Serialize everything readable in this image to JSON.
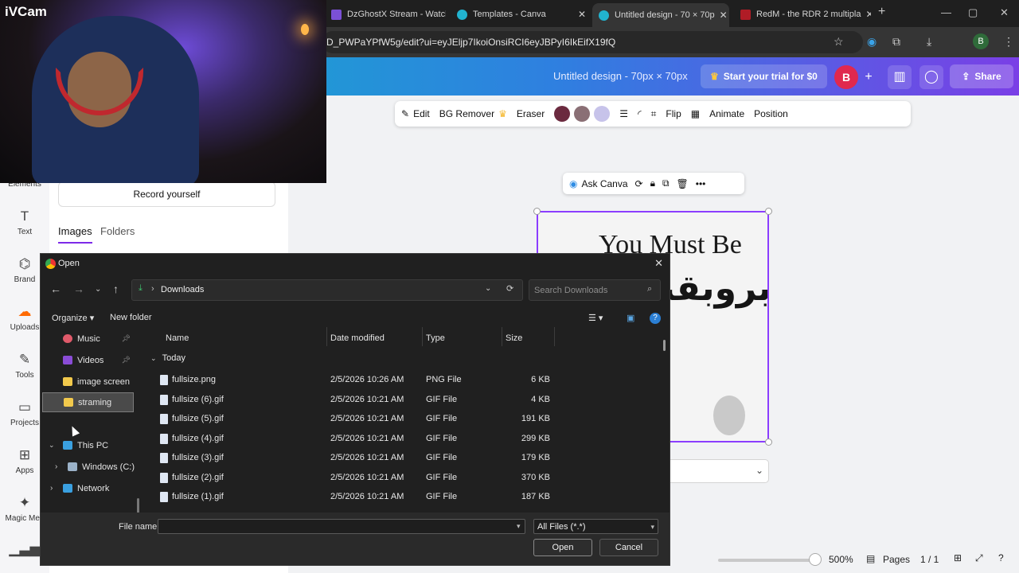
{
  "browser": {
    "tabs": [
      {
        "title": "DzGhostX Stream - Watch",
        "active": false
      },
      {
        "title": "Templates - Canva",
        "active": false
      },
      {
        "title": "Untitled design - 70 × 70p",
        "active": true
      },
      {
        "title": "RedM - the RDR 2 multipla",
        "active": false
      }
    ],
    "new_tab": "+",
    "url": "D_PWPaYPfW5g/edit?ui=eyJEljp7IkoiOnsiRCI6eyJBPyI6IkEifX19fQ",
    "profile_initial": "B"
  },
  "webcam": {
    "label": "iVCam"
  },
  "canva": {
    "design_title": "Untitled design - 70px × 70px",
    "trial_button": "Start your trial for $0",
    "user_initial": "B",
    "share_button": "Share",
    "rail": [
      {
        "label": "Elements",
        "icon": "elements-icon"
      },
      {
        "label": "Text",
        "icon": "text-icon"
      },
      {
        "label": "Brand",
        "icon": "brand-icon"
      },
      {
        "label": "Uploads",
        "icon": "uploads-icon"
      },
      {
        "label": "Tools",
        "icon": "tools-icon"
      },
      {
        "label": "Projects",
        "icon": "projects-icon"
      },
      {
        "label": "Apps",
        "icon": "apps-icon"
      },
      {
        "label": "Magic Med",
        "icon": "magic-media-icon"
      }
    ],
    "panel": {
      "record_button": "Record yourself",
      "tabs": [
        "Images",
        "Folders"
      ]
    },
    "toolbar": {
      "edit": "Edit",
      "bg_remover": "BG Remover",
      "eraser": "Eraser",
      "colors": [
        "#6b2a3f",
        "#8a6f75",
        "#c7c3ea"
      ],
      "flip": "Flip",
      "animate": "Animate",
      "position": "Position"
    },
    "context_toolbar": {
      "ask_canva": "Ask Canva"
    },
    "canvas_text": {
      "english": "You Must Be",
      "arabic": "بروبقند"
    },
    "footer": {
      "zoom": "500%",
      "pages_label": "Pages",
      "page_count": "1 / 1"
    },
    "zoom_level_percent": 500
  },
  "dialog": {
    "title": "Open",
    "path": "Downloads",
    "search_placeholder": "Search Downloads",
    "organize": "Organize",
    "new_folder": "New folder",
    "nav": [
      {
        "label": "Music",
        "icon": "music-icon",
        "pinned": true,
        "color": "#e05a6a"
      },
      {
        "label": "Videos",
        "icon": "videos-icon",
        "pinned": true,
        "color": "#8a4cd6"
      },
      {
        "label": "image screen",
        "icon": "folder-icon",
        "pinned": false,
        "color": "#f2c94c"
      },
      {
        "label": "straming",
        "icon": "folder-icon",
        "pinned": false,
        "color": "#f2c94c",
        "selected": true
      },
      {
        "label": "This PC",
        "icon": "computer-icon",
        "pinned": false,
        "color": "#3aa0e0"
      },
      {
        "label": "Windows (C:)",
        "icon": "drive-icon",
        "pinned": false,
        "color": "#9bb2c8"
      },
      {
        "label": "Network",
        "icon": "network-icon",
        "pinned": false,
        "color": "#3aa0e0"
      }
    ],
    "columns": {
      "name": "Name",
      "date": "Date modified",
      "type": "Type",
      "size": "Size"
    },
    "group": "Today",
    "files": [
      {
        "name": "fullsize.png",
        "date": "2/5/2026 10:26 AM",
        "type": "PNG File",
        "size": "6 KB"
      },
      {
        "name": "fullsize (6).gif",
        "date": "2/5/2026 10:21 AM",
        "type": "GIF File",
        "size": "4 KB"
      },
      {
        "name": "fullsize (5).gif",
        "date": "2/5/2026 10:21 AM",
        "type": "GIF File",
        "size": "191 KB"
      },
      {
        "name": "fullsize (4).gif",
        "date": "2/5/2026 10:21 AM",
        "type": "GIF File",
        "size": "299 KB"
      },
      {
        "name": "fullsize (3).gif",
        "date": "2/5/2026 10:21 AM",
        "type": "GIF File",
        "size": "179 KB"
      },
      {
        "name": "fullsize (2).gif",
        "date": "2/5/2026 10:21 AM",
        "type": "GIF File",
        "size": "370 KB"
      },
      {
        "name": "fullsize (1).gif",
        "date": "2/5/2026 10:21 AM",
        "type": "GIF File",
        "size": "187 KB"
      }
    ],
    "file_name_label": "File name:",
    "file_name_value": "",
    "file_type": "All Files (*.*)",
    "open_button": "Open",
    "cancel_button": "Cancel"
  }
}
